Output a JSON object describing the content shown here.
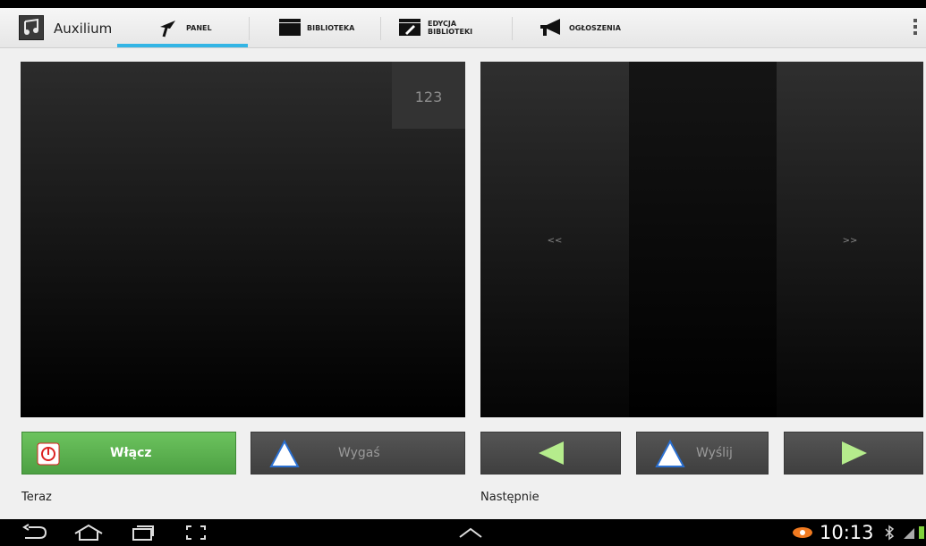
{
  "app": {
    "title": "Auxilium"
  },
  "tabs": [
    {
      "label": "PANEL",
      "icon": "panel-pin-icon",
      "active": true
    },
    {
      "label": "BIBLIOTEKA",
      "icon": "folder-icon",
      "active": false
    },
    {
      "label_line1": "EDYCJA",
      "label_line2": "BIBLIOTEKI",
      "icon": "folder-edit-icon",
      "active": false
    },
    {
      "label": "OGŁOSZENIA",
      "icon": "megaphone-icon",
      "active": false
    }
  ],
  "left_panel": {
    "counter": "123"
  },
  "right_panel": {
    "prev_label": "<<",
    "next_label": ">>"
  },
  "buttons": {
    "on": "Włącz",
    "blank": "Wygaś",
    "send": "Wyślij"
  },
  "captions": {
    "now": "Teraz",
    "next": "Następnie"
  },
  "system": {
    "clock": "10:13"
  },
  "colors": {
    "accent": "#33b5e5",
    "green": "#5cb850"
  }
}
